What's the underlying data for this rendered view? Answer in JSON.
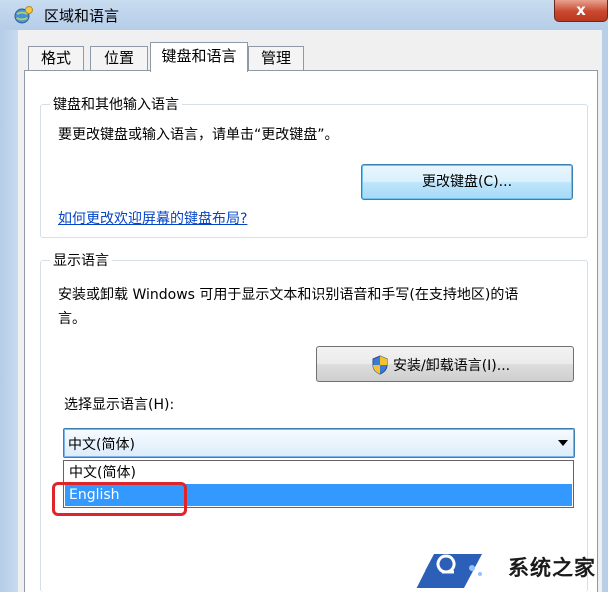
{
  "window": {
    "title": "区域和语言",
    "close_label": "x"
  },
  "tabs": [
    {
      "label": "格式",
      "active": false
    },
    {
      "label": "位置",
      "active": false
    },
    {
      "label": "键盘和语言",
      "active": true
    },
    {
      "label": "管理",
      "active": false
    }
  ],
  "keyboard_group": {
    "title": "键盘和其他输入语言",
    "description": "要更改键盘或输入语言，请单击“更改键盘”。",
    "change_keyboard_button": "更改键盘(C)...",
    "help_link": "如何更改欢迎屏幕的键盘布局?"
  },
  "display_group": {
    "title": "显示语言",
    "description_line1": "安装或卸载 Windows 可用于显示文本和识别语音和手写(在支持地区)的语",
    "description_line2": "言。",
    "install_button": "安装/卸载语言(I)...",
    "select_label": "选择显示语言(H):",
    "combo_value": "中文(简体)",
    "options": [
      {
        "label": "中文(简体)",
        "selected": false
      },
      {
        "label": "English",
        "selected": true
      }
    ]
  },
  "watermark": {
    "text": "系统之家"
  },
  "colors": {
    "accent_selection": "#3399ff",
    "highlight_annotation": "#e0252a",
    "link": "#0645c5"
  }
}
